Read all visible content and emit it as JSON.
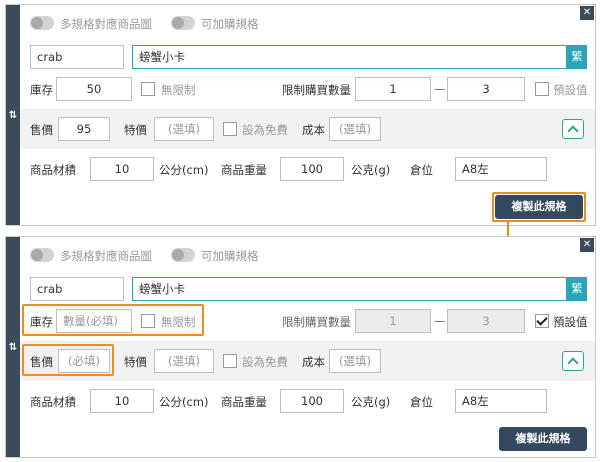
{
  "panel_before": {
    "toggle_images_label": "多規格對應商品圖",
    "toggle_addon_label": "可加購規格",
    "sku_value": "crab",
    "name_value": "螃蟹小卡",
    "name_btn_label": "繁",
    "stock_label": "庫存",
    "stock_value": "50",
    "unlimited_label": "無限制",
    "limit_label": "限制購買數量",
    "limit_min": "1",
    "limit_dash": "—",
    "limit_max": "3",
    "default_label": "預設值",
    "price_label": "售價",
    "price_value": "95",
    "special_label": "特價",
    "special_placeholder": "(選填)",
    "free_label": "設為免費",
    "cost_label": "成本",
    "cost_placeholder": "(選填)",
    "volume_label": "商品材積",
    "volume_value": "10",
    "volume_unit": "公分(cm)",
    "weight_label": "商品重量",
    "weight_value": "100",
    "weight_unit": "公克(g)",
    "location_label": "倉位",
    "location_value": "A8左",
    "copy_label": "複製此規格"
  },
  "panel_after": {
    "toggle_images_label": "多規格對應商品圖",
    "toggle_addon_label": "可加購規格",
    "sku_value": "crab",
    "name_value": "螃蟹小卡",
    "name_btn_label": "繁",
    "stock_label": "庫存",
    "stock_placeholder": "數量(必填)",
    "unlimited_label": "無限制",
    "limit_label": "限制購買數量",
    "limit_min": "1",
    "limit_dash": "—",
    "limit_max": "3",
    "default_label": "預設值",
    "price_label": "售價",
    "price_placeholder": "(必填)",
    "special_label": "特價",
    "special_placeholder": "(選填)",
    "free_label": "設為免費",
    "cost_label": "成本",
    "cost_placeholder": "(選填)",
    "volume_label": "商品材積",
    "volume_value": "10",
    "volume_unit": "公分(cm)",
    "weight_label": "商品重量",
    "weight_value": "100",
    "weight_unit": "公克(g)",
    "location_label": "倉位",
    "location_value": "A8左",
    "copy_label": "複製此規格"
  },
  "icons": {
    "close": "close-icon",
    "drag": "drag-handle-icon",
    "collapse": "chevron-up-icon",
    "arrow": "arrow-down-icon"
  },
  "colors": {
    "accent_teal": "#2ba5b5",
    "dark_navy": "#34495e",
    "highlight_orange": "#f08c1e"
  }
}
